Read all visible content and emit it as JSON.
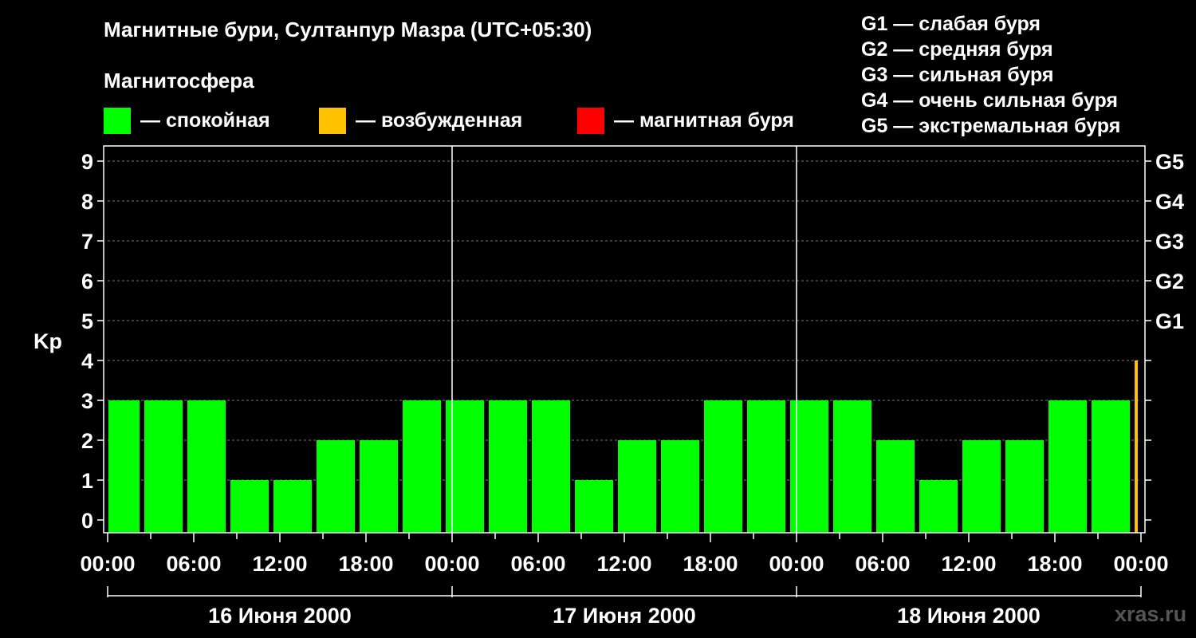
{
  "title": "Магнитные бури, Султанпур Мазра (UTC+05:30)",
  "magnetosphere": {
    "label": "Магнитосфера",
    "legend": [
      {
        "text": "— спокойная",
        "color": "#00ff00"
      },
      {
        "text": "— возбужденная",
        "color": "#ffc000"
      },
      {
        "text": "— магнитная буря",
        "color": "#ff0000"
      }
    ]
  },
  "g_legend": [
    "G1 — слабая буря",
    "G2 — средняя буря",
    "G3 — сильная буря",
    "G4 — очень сильная буря",
    "G5 — экстремальная буря"
  ],
  "watermark": "xras.ru",
  "chart_data": {
    "type": "bar",
    "ylabel": "Kp",
    "ylim": [
      0,
      9
    ],
    "y_ticks": [
      "0",
      "1",
      "2",
      "3",
      "4",
      "5",
      "6",
      "7",
      "8",
      "9"
    ],
    "right_ticks": [
      {
        "kp": 5,
        "label": "G1"
      },
      {
        "kp": 6,
        "label": "G2"
      },
      {
        "kp": 7,
        "label": "G3"
      },
      {
        "kp": 8,
        "label": "G4"
      },
      {
        "kp": 9,
        "label": "G5"
      }
    ],
    "x_tick_labels": [
      "00:00",
      "06:00",
      "12:00",
      "18:00",
      "00:00",
      "06:00",
      "12:00",
      "18:00",
      "00:00",
      "06:00",
      "12:00",
      "18:00",
      "00:00"
    ],
    "dates": [
      "16 Июня 2000",
      "17 Июня 2000",
      "18 Июня 2000"
    ],
    "grid": true,
    "bars": [
      {
        "start": "16 Июня 2000 00:00",
        "kp": 3,
        "color": "#00ff00"
      },
      {
        "start": "16 Июня 2000 02:30",
        "kp": 3,
        "color": "#00ff00"
      },
      {
        "start": "16 Июня 2000 05:30",
        "kp": 3,
        "color": "#00ff00"
      },
      {
        "start": "16 Июня 2000 08:30",
        "kp": 1,
        "color": "#00ff00"
      },
      {
        "start": "16 Июня 2000 11:30",
        "kp": 1,
        "color": "#00ff00"
      },
      {
        "start": "16 Июня 2000 14:30",
        "kp": 2,
        "color": "#00ff00"
      },
      {
        "start": "16 Июня 2000 17:30",
        "kp": 2,
        "color": "#00ff00"
      },
      {
        "start": "16 Июня 2000 20:30",
        "kp": 3,
        "color": "#00ff00"
      },
      {
        "start": "16 Июня 2000 23:30",
        "kp": 3,
        "color": "#00ff00"
      },
      {
        "start": "17 Июня 2000 02:30",
        "kp": 3,
        "color": "#00ff00"
      },
      {
        "start": "17 Июня 2000 05:30",
        "kp": 3,
        "color": "#00ff00"
      },
      {
        "start": "17 Июня 2000 08:30",
        "kp": 1,
        "color": "#00ff00"
      },
      {
        "start": "17 Июня 2000 11:30",
        "kp": 2,
        "color": "#00ff00"
      },
      {
        "start": "17 Июня 2000 14:30",
        "kp": 2,
        "color": "#00ff00"
      },
      {
        "start": "17 Июня 2000 17:30",
        "kp": 3,
        "color": "#00ff00"
      },
      {
        "start": "17 Июня 2000 20:30",
        "kp": 3,
        "color": "#00ff00"
      },
      {
        "start": "17 Июня 2000 23:30",
        "kp": 3,
        "color": "#00ff00"
      },
      {
        "start": "18 Июня 2000 02:30",
        "kp": 3,
        "color": "#00ff00"
      },
      {
        "start": "18 Июня 2000 05:30",
        "kp": 2,
        "color": "#00ff00"
      },
      {
        "start": "18 Июня 2000 08:30",
        "kp": 1,
        "color": "#00ff00"
      },
      {
        "start": "18 Июня 2000 11:30",
        "kp": 2,
        "color": "#00ff00"
      },
      {
        "start": "18 Июня 2000 14:30",
        "kp": 2,
        "color": "#00ff00"
      },
      {
        "start": "18 Июня 2000 17:30",
        "kp": 3,
        "color": "#00ff00"
      },
      {
        "start": "18 Июня 2000 20:30",
        "kp": 3,
        "color": "#00ff00"
      },
      {
        "start": "18 Июня 2000 23:30",
        "kp": 4,
        "color": "#ffc000"
      }
    ]
  }
}
